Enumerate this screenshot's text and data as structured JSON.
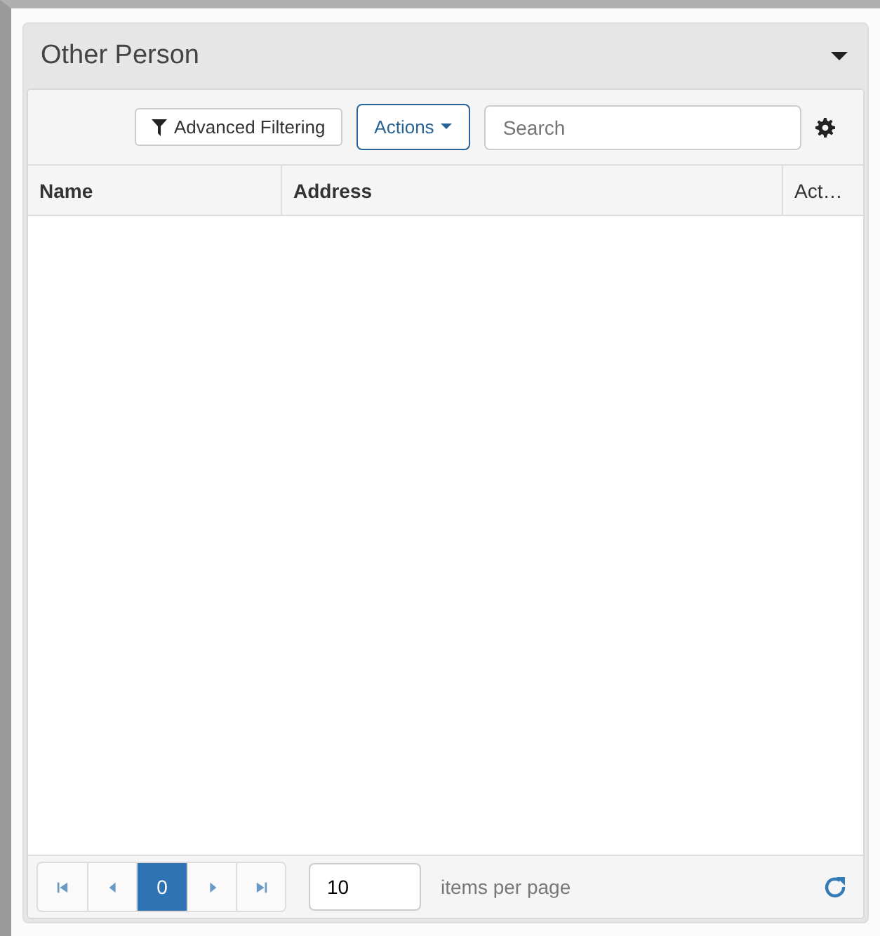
{
  "panel": {
    "title": "Other Person",
    "expanded": true
  },
  "toolbar": {
    "filter_button": "Advanced Filtering",
    "actions_button": "Actions",
    "search": {
      "placeholder": "Search"
    }
  },
  "table": {
    "columns": [
      "Name",
      "Address",
      "Act…"
    ]
  },
  "pager": {
    "pages": [
      {
        "label": "0",
        "selected": true
      }
    ],
    "page_size": "10",
    "page_size_label": "items per page"
  }
}
